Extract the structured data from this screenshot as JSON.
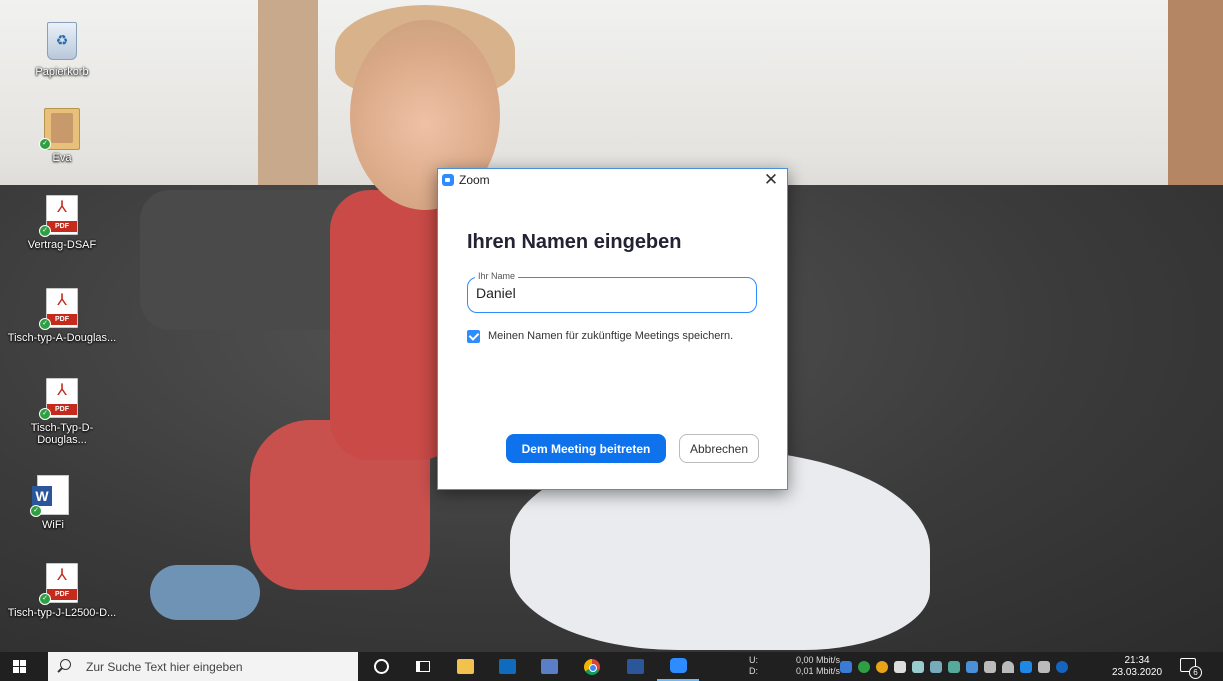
{
  "desktop": {
    "icons": [
      {
        "label": "Papierkorb",
        "icon": "recycle-bin-icon"
      },
      {
        "label": "Eva",
        "icon": "folder-icon"
      },
      {
        "label": "Vertrag-DSAF",
        "icon": "pdf-icon",
        "badge": "PDF"
      },
      {
        "label": "Tisch-typ-A-Douglas...",
        "icon": "pdf-icon",
        "badge": "PDF"
      },
      {
        "label": "Tisch-Typ-D-Douglas...",
        "icon": "pdf-icon",
        "badge": "PDF"
      },
      {
        "label": "WiFi",
        "icon": "word-doc-icon",
        "badge": "W"
      },
      {
        "label": "Tisch-typ-J-L2500-D...",
        "icon": "pdf-icon",
        "badge": "PDF"
      }
    ]
  },
  "dialog": {
    "title": "Zoom",
    "close_glyph": "✕",
    "heading": "Ihren Namen eingeben",
    "name_label": "Ihr Name",
    "name_value": "Daniel",
    "remember_label": "Meinen Namen für zukünftige Meetings speichern.",
    "remember_checked": true,
    "join_label": "Dem Meeting beitreten",
    "cancel_label": "Abbrechen",
    "accent_color": "#0e72ed"
  },
  "taskbar": {
    "search_placeholder": "Zur Suche Text hier eingeben",
    "apps": [
      "cortana-icon",
      "task-view-icon",
      "file-explorer-icon",
      "outlook-icon",
      "app-icon",
      "chrome-icon",
      "word-icon",
      "zoom-icon"
    ],
    "net_upload_label": "U:",
    "net_upload_value": "0,00 Mbit/s",
    "net_download_label": "D:",
    "net_download_value": "0,01 Mbit/s",
    "time": "21:34",
    "date": "23.03.2020",
    "notification_count": "6"
  }
}
